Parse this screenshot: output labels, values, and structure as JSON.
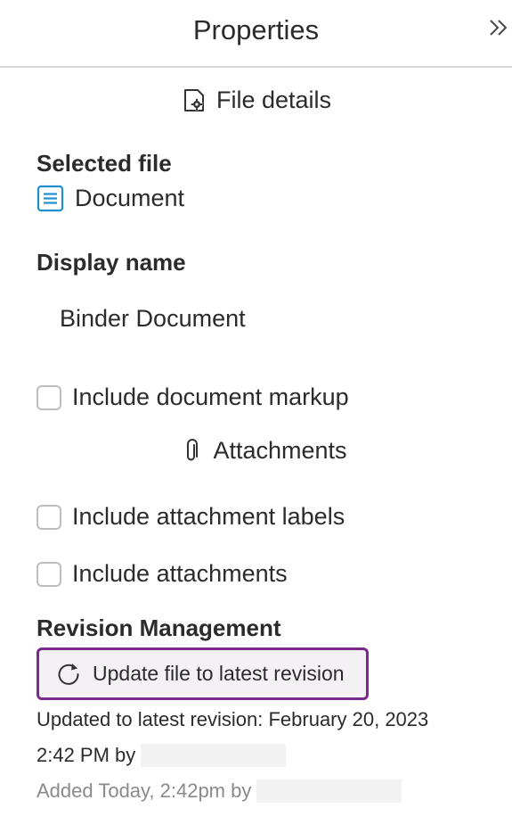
{
  "header": {
    "title": "Properties",
    "collapse_icon": "double-chevron-right-icon"
  },
  "file_details": {
    "label": "File details",
    "icon": "file-settings-icon"
  },
  "selected_file": {
    "label": "Selected file",
    "file_name": "Document",
    "icon": "document-icon",
    "icon_color": "#1f8fd1"
  },
  "display_name": {
    "label": "Display name",
    "value": "Binder Document"
  },
  "options": {
    "include_markup": "Include document markup",
    "attachments_label": "Attachments",
    "attachments_icon": "paperclip-icon",
    "include_attachment_labels": "Include attachment labels",
    "include_attachments": "Include attachments"
  },
  "revision": {
    "label": "Revision Management",
    "button_label": "Update file to latest revision",
    "button_icon": "refresh-icon",
    "button_border_color": "#7a2a8c",
    "updated_line1": "Updated to latest revision: February 20, 2023",
    "updated_line2": "2:42 PM by",
    "added_line": "Added Today, 2:42pm by"
  }
}
